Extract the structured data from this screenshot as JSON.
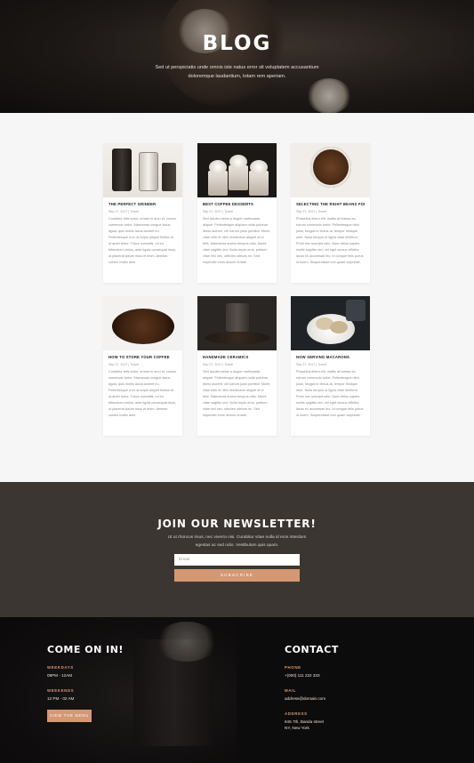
{
  "hero": {
    "title": "BLOG",
    "subtitle": "Sed ut perspiciatis unde omnis iste natus error sit voluptatem accusantium doloremque laudantium, totam rem aperiam."
  },
  "posts": [
    {
      "title": "THE PERFECT GRINDER",
      "meta": "Sep 27, 2017 | Travel",
      "excerpt": "Curabitur tells tortor, ornare in arcu et, cursus commodo tortor. Maecenas congue lacus ligula, quis mollis lacus laoreet eu. Pellentesque a ex at turpis aliquet finibus id ut amet tortor. Fusce convallis, mi eu bibendum varius, ante ligula consequat risus, ut placerat ipsum risus et enim. Aenean cursus mollis ante."
    },
    {
      "title": "BEST COFFEE DESSERTS",
      "meta": "Sep 27, 2017 | Travel",
      "excerpt": "Sed iaculis metus a augue malesuada aliquet. Pellentesque aliquam nulla pulvinar libero laoreet, vel rutrum justo porttitor. Morbi vitae nibh et nibh vestibulum aliquet at ut felis. Maecenas auctor tempus odio. Morbi vitae sagittis orci. Nulla turpis eros, pretium vitae nisl nec, ultricies ultrices mi. Sed imperdiet enim dictum ornare."
    },
    {
      "title": "SELECTING THE RIGHT BEANS FOR YOU",
      "meta": "Sep 27, 2017 | Travel",
      "excerpt": "Phasellus libero elit, mattis at massa ac, rutrum commodo tortor. Pellentesque nibh justo, feugiat in lectus at, tempor tristique ante. Nulla tempor ut ligula vitae eleifend. Proin nec suscipit odio. Nunc tellus sapien, mollis sagittis orci, vel eget cursus efficitur, lacus ex accumsan leo, id congue felis purus id lorem. Suspendisse non quam vulputate."
    },
    {
      "title": "HOW TO STORE YOUR COFFEE",
      "meta": "Sep 27, 2017 | Travel",
      "excerpt": "Curabitur tells tortor, ornare in arcu et, cursus commodo tortor. Maecenas congue lacus ligula, quis mollis lacus laoreet eu. Pellentesque a ex at turpis aliquet finibus id ut amet tortor. Fusce convallis, mi eu bibendum varius, ante ligula consequat risus, ut placerat ipsum risus et enim. Aenean cursus mollis ante."
    },
    {
      "title": "HANDMADE CERAMICS",
      "meta": "Sep 27, 2017 | Travel",
      "excerpt": "Sed iaculis metus a augue malesuada aliquet. Pellentesque aliquam nulla pulvinar libero laoreet, vel rutrum justo porttitor. Morbi vitae nibh et nibh vestibulum aliquet at ut felis. Maecenas auctor tempus odio. Morbi vitae sagittis orci. Nulla turpis eros, pretium vitae nisl nec, ultricies ultrices mi. Sed imperdiet enim dictum ornare."
    },
    {
      "title": "NOW SERVING MACARONS",
      "meta": "Sep 27, 2017 | Travel",
      "excerpt": "Phasellus libero elit, mattis at massa ac, rutrum commodo tortor. Pellentesque nibh justo, feugiat in lectus at, tempor tristique ante. Nulla tempor ut ligula vitae eleifend. Proin nec suscipit odio. Nunc tellus sapien, mollis sagittis orci, vel eget cursus efficitur, lacus ex accumsan leo, id congue felis purus id lorem. Suspendisse non quam vulputate."
    }
  ],
  "newsletter": {
    "title": "JOIN OUR NEWSLETTER!",
    "subtitle": "Ut ut rhoncus risus, nec viverra nisi. Curabitur vitae nulla id eros interdum egestas ac sed odio. Vestibulum quis quam.",
    "email_placeholder": "Email",
    "button_label": "SUBSCRIBE"
  },
  "footer": {
    "left": {
      "heading": "COME ON IN!",
      "weekdays_label": "WEEKDAYS",
      "weekdays_hours": "08PM - 12AM",
      "weekends_label": "WEEKENDS",
      "weekends_hours": "12 PM - 02 AM",
      "menu_button": "VIEW THE MENU"
    },
    "right": {
      "heading": "CONTACT",
      "phone_label": "PHONE",
      "phone": "+(000) 111 222 333",
      "mail_label": "MAIL",
      "mail": "address@domain.com",
      "address_label": "ADDRESS",
      "address_line1": "645 7th, Banda street",
      "address_line2": "NY, New York"
    }
  },
  "colors": {
    "accent": "#d49874",
    "newsletter_bg": "#3b3631",
    "footer_bg": "#0d0c0c",
    "page_bg": "#f6f6f6"
  }
}
